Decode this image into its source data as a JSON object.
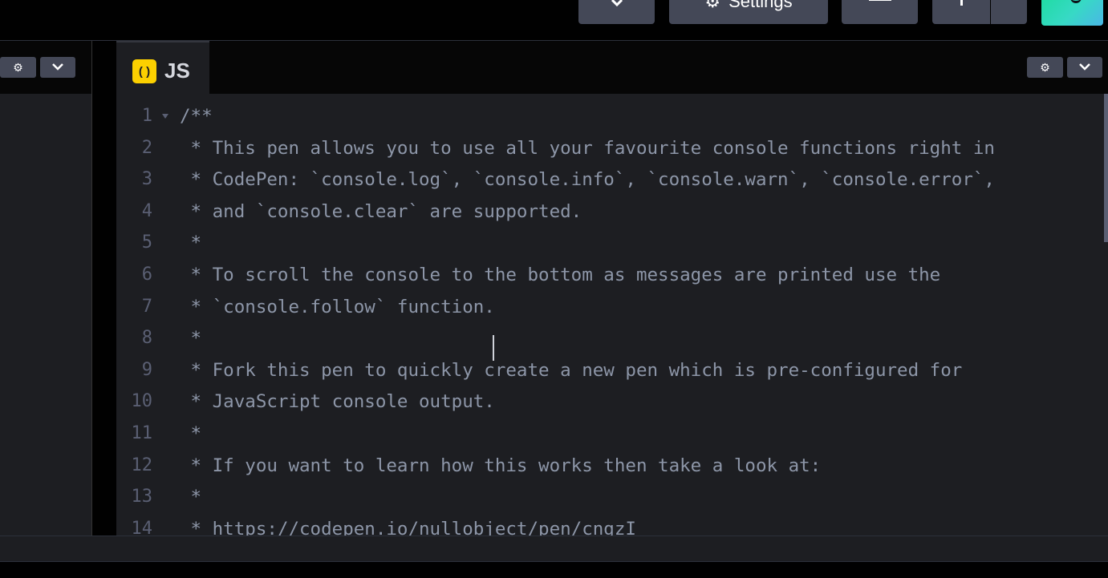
{
  "header": {
    "settings_label": "Settings"
  },
  "js_editor": {
    "tab_label": "JS",
    "lines": [
      {
        "num": "1",
        "text": "/**"
      },
      {
        "num": "2",
        "text": " * This pen allows you to use all your favourite console functions right in"
      },
      {
        "num": "3",
        "text": " * CodePen: `console.log`, `console.info`, `console.warn`, `console.error`,"
      },
      {
        "num": "4",
        "text": " * and `console.clear` are supported."
      },
      {
        "num": "5",
        "text": " *"
      },
      {
        "num": "6",
        "text": " * To scroll the console to the bottom as messages are printed use the"
      },
      {
        "num": "7",
        "text": " * `console.follow` function."
      },
      {
        "num": "8",
        "text": " *"
      },
      {
        "num": "9",
        "text": " * Fork this pen to quickly create a new pen which is pre-configured for"
      },
      {
        "num": "10",
        "text": " * JavaScript console output."
      },
      {
        "num": "11",
        "text": " *"
      },
      {
        "num": "12",
        "text": " * If you want to learn how this works then take a look at:"
      },
      {
        "num": "13",
        "text": " *"
      },
      {
        "num": "14",
        "text": " * https://codepen.io/nullobject/pen/cngzI"
      }
    ]
  },
  "colors": {
    "editor_bg": "#1d1e22",
    "js_badge": "#fcd000",
    "button_bg": "#444857"
  }
}
